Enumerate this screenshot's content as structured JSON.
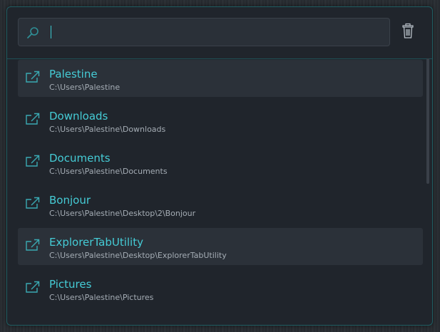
{
  "search": {
    "value": "",
    "placeholder": ""
  },
  "toolbar": {
    "clear_icon": "trash-icon"
  },
  "colors": {
    "accent": "#45ccd6",
    "border": "#1f5d62",
    "background": "#20252c",
    "highlight": "#2b3139"
  },
  "items": [
    {
      "title": "Palestine",
      "path": "C:\\Users\\Palestine",
      "highlighted": true
    },
    {
      "title": "Downloads",
      "path": "C:\\Users\\Palestine\\Downloads",
      "highlighted": false
    },
    {
      "title": "Documents",
      "path": "C:\\Users\\Palestine\\Documents",
      "highlighted": false
    },
    {
      "title": "Bonjour",
      "path": "C:\\Users\\Palestine\\Desktop\\2\\Bonjour",
      "highlighted": false
    },
    {
      "title": "ExplorerTabUtility",
      "path": "C:\\Users\\Palestine\\Desktop\\ExplorerTabUtility",
      "highlighted": true
    },
    {
      "title": "Pictures",
      "path": "C:\\Users\\Palestine\\Pictures",
      "highlighted": false
    }
  ]
}
